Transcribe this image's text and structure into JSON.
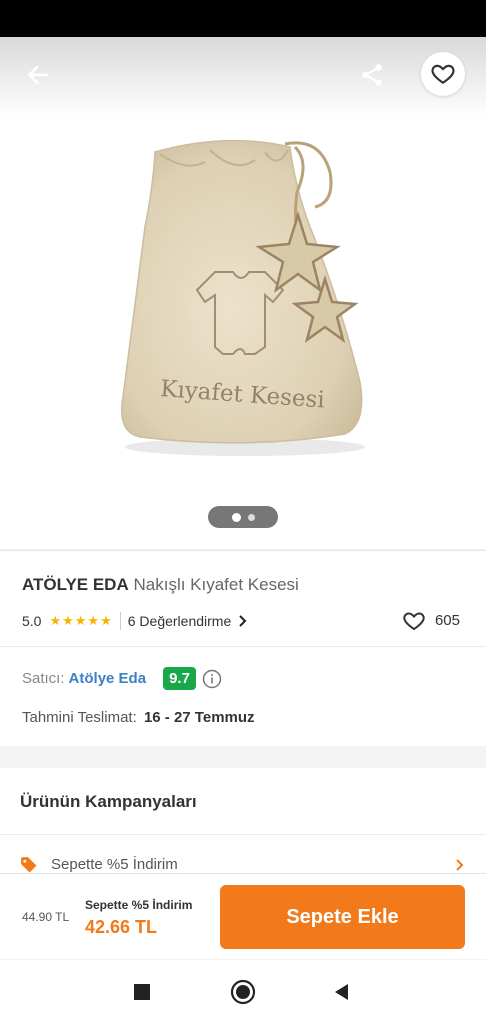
{
  "product": {
    "brand": "ATÖLYE EDA",
    "name": "Nakışlı Kıyafet Kesesi",
    "bag_print": "Kıyafet Kesesi"
  },
  "rating": {
    "score": "5.0",
    "stars": "★★★★★",
    "reviews_label": "6 Değerlendirme",
    "favorites_count": "605"
  },
  "seller": {
    "label": "Satıcı:",
    "name": "Atölye Eda",
    "score": "9.7"
  },
  "delivery": {
    "label": "Tahmini Teslimat:",
    "value": "16 - 27 Temmuz"
  },
  "campaigns": {
    "title": "Ürünün Kampanyaları",
    "items": [
      {
        "label": "Sepette %5 İndirim"
      }
    ]
  },
  "pricing": {
    "old_price": "44.90 TL",
    "promo_label": "Sepette %5 İndirim",
    "new_price": "42.66 TL",
    "add_to_cart_label": "Sepete Ekle"
  },
  "gallery": {
    "image_count": 2,
    "active_index": 0
  },
  "colors": {
    "accent": "#f27a1a",
    "seller_score": "#18a84a",
    "star": "#f5b400",
    "link": "#3d7fc2"
  },
  "icons": [
    "arrow-left-icon",
    "share-icon",
    "heart-icon",
    "info-icon",
    "tag-icon",
    "chevron-right-icon",
    "nav-recents-icon",
    "nav-home-icon",
    "nav-back-icon"
  ]
}
